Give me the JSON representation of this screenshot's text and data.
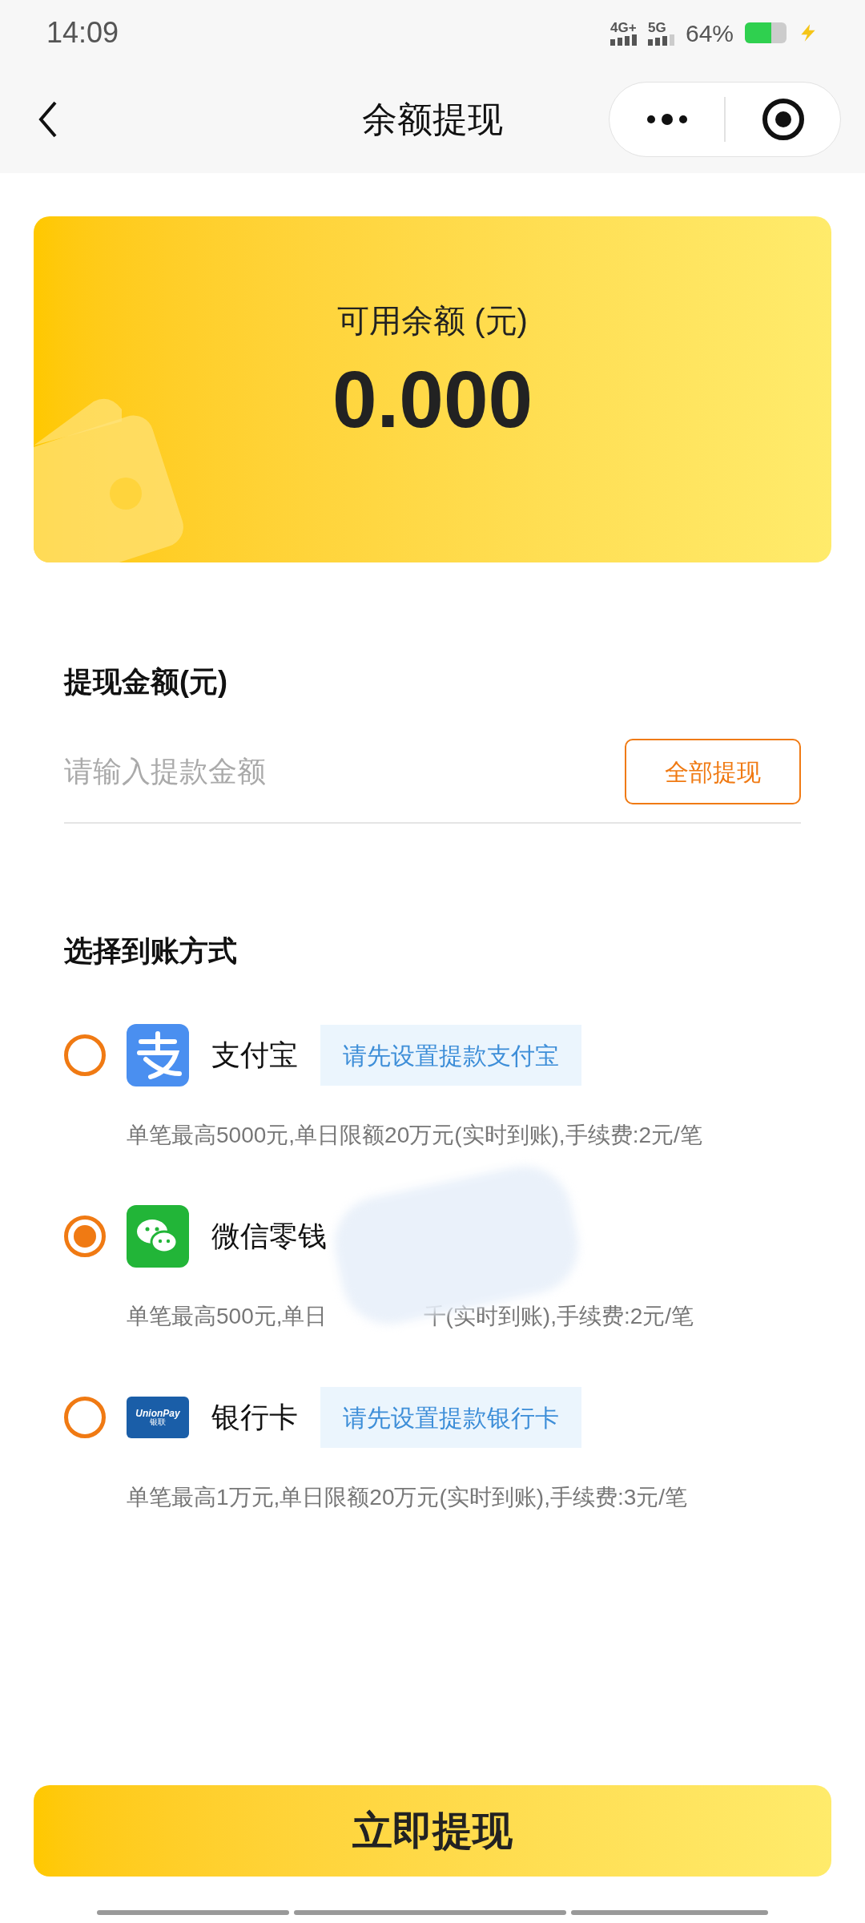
{
  "status_bar": {
    "time": "14:09",
    "network_1": "4G+",
    "network_2": "5G",
    "battery": "64%"
  },
  "nav": {
    "title": "余额提现"
  },
  "balance": {
    "label": "可用余额 (元)",
    "amount": "0.000"
  },
  "amount_section": {
    "title": "提现金额(元)",
    "placeholder": "请输入提款金额",
    "all_button": "全部提现"
  },
  "methods_section": {
    "title": "选择到账方式"
  },
  "methods": [
    {
      "kind": "alipay",
      "name": "支付宝",
      "selected": false,
      "setup_button": "请先设置提款支付宝",
      "limit_parts": [
        "单笔最高5000元,单日限额20万元(实时到账),手续费:2元/笔"
      ]
    },
    {
      "kind": "wechat",
      "name": "微信零钱",
      "selected": true,
      "redacted": true,
      "limit_parts": [
        "单笔最高500元,单日",
        "千(实时到账),手续费:2元/笔"
      ]
    },
    {
      "kind": "bank",
      "name": "银行卡",
      "selected": false,
      "logo_text": [
        "UnionPay",
        "银联"
      ],
      "setup_button": "请先设置提款银行卡",
      "limit_parts": [
        "单笔最高1万元,单日限额20万元(实时到账),手续费:3元/笔"
      ]
    }
  ],
  "submit_button": "立即提现"
}
